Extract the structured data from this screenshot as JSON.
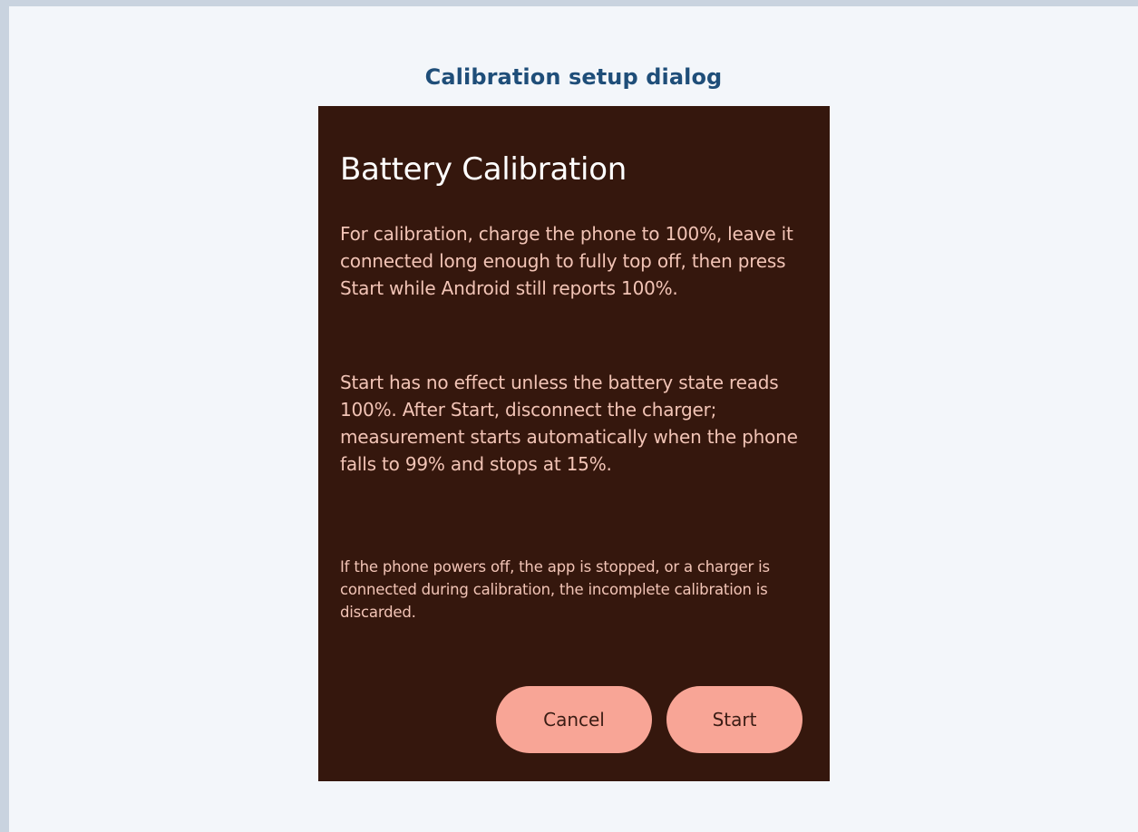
{
  "caption": "Calibration setup dialog",
  "dialog": {
    "title": "Battery Calibration",
    "paragraph1": "For calibration, charge the phone to 100%, leave it connected long enough to fully top off, then press Start while Android still reports 100%.",
    "paragraph2": "Start has no effect unless the battery state reads 100%. After Start, disconnect the charger; measurement starts automatically when the phone falls to 99% and stops at 15%.",
    "paragraph3": "If the phone powers off, the app is stopped, or a charger is connected during calibration, the incomplete calibration is discarded.",
    "cancel_label": "Cancel",
    "start_label": "Start"
  },
  "colors": {
    "caption": "#1f4e79",
    "dialog_background": "#35170d",
    "title_text": "#ffffff",
    "body_text": "#f2c4b6",
    "button_background": "#f8a596",
    "button_text": "#3a1c14"
  }
}
